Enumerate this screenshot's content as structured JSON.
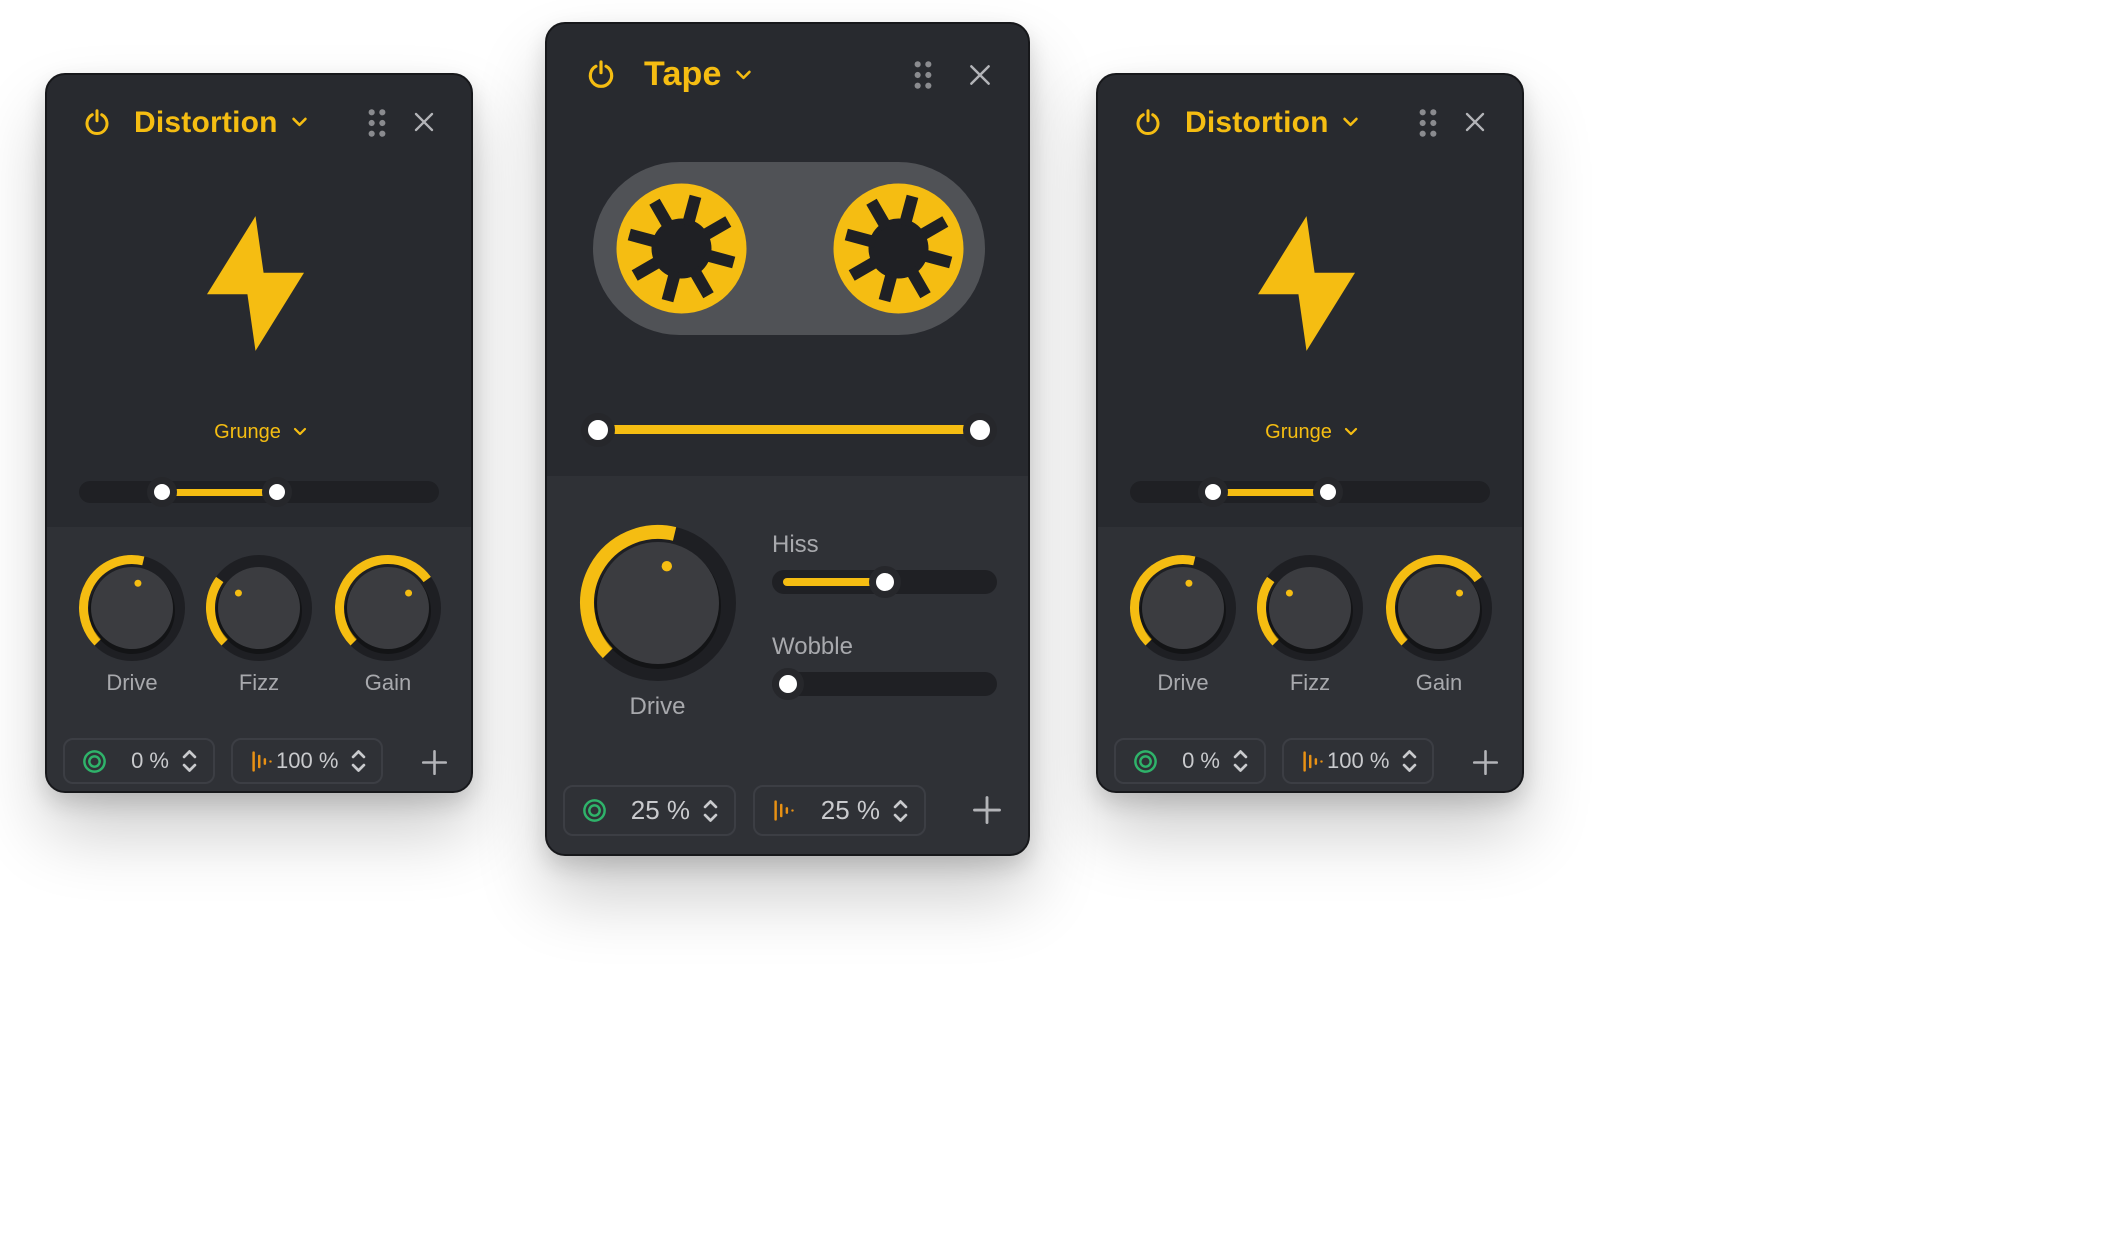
{
  "colors": {
    "accent": "#f5bd12",
    "panel_bg": "#282a2f",
    "lower_bg": "#2f3136",
    "track": "#1f2024",
    "knob": "#3b3c40",
    "knob_ring_bg": "#1e1f23",
    "text_muted": "#a8a9ad",
    "green": "#2fb36a",
    "orange": "#e89114"
  },
  "left_panel": {
    "title": "Distortion",
    "icons": {
      "power": "power-icon",
      "chevron": "chevron-down-icon",
      "handle": "drag-handle-icon",
      "close": "close-icon",
      "art": "lightning-bolt-icon"
    },
    "preset": "Grunge",
    "range": {
      "start": 0.23,
      "end": 0.55
    },
    "knobs": [
      {
        "label": "Drive",
        "value": 0.55
      },
      {
        "label": "Fizz",
        "value": 0.3
      },
      {
        "label": "Gain",
        "value": 0.7
      }
    ],
    "mix": "0 %",
    "output": "100 %"
  },
  "center_panel": {
    "title": "Tape",
    "icons": {
      "power": "power-icon",
      "chevron": "chevron-down-icon",
      "handle": "drag-handle-icon",
      "close": "close-icon",
      "art": "tape-reel-icon"
    },
    "range": {
      "start": 0.0,
      "end": 1.0
    },
    "knob": {
      "label": "Drive",
      "value": 0.55
    },
    "sliders": [
      {
        "label": "Hiss",
        "value": 0.5
      },
      {
        "label": "Wobble",
        "value": 0.0
      }
    ],
    "mix": "25 %",
    "output": "25 %"
  },
  "right_panel": {
    "title": "Distortion",
    "icons": {
      "power": "power-icon",
      "chevron": "chevron-down-icon",
      "handle": "drag-handle-icon",
      "close": "close-icon",
      "art": "lightning-bolt-icon"
    },
    "preset": "Grunge",
    "range": {
      "start": 0.23,
      "end": 0.55
    },
    "knobs": [
      {
        "label": "Drive",
        "value": 0.55
      },
      {
        "label": "Fizz",
        "value": 0.3
      },
      {
        "label": "Gain",
        "value": 0.7
      }
    ],
    "mix": "0 %",
    "output": "100 %"
  }
}
